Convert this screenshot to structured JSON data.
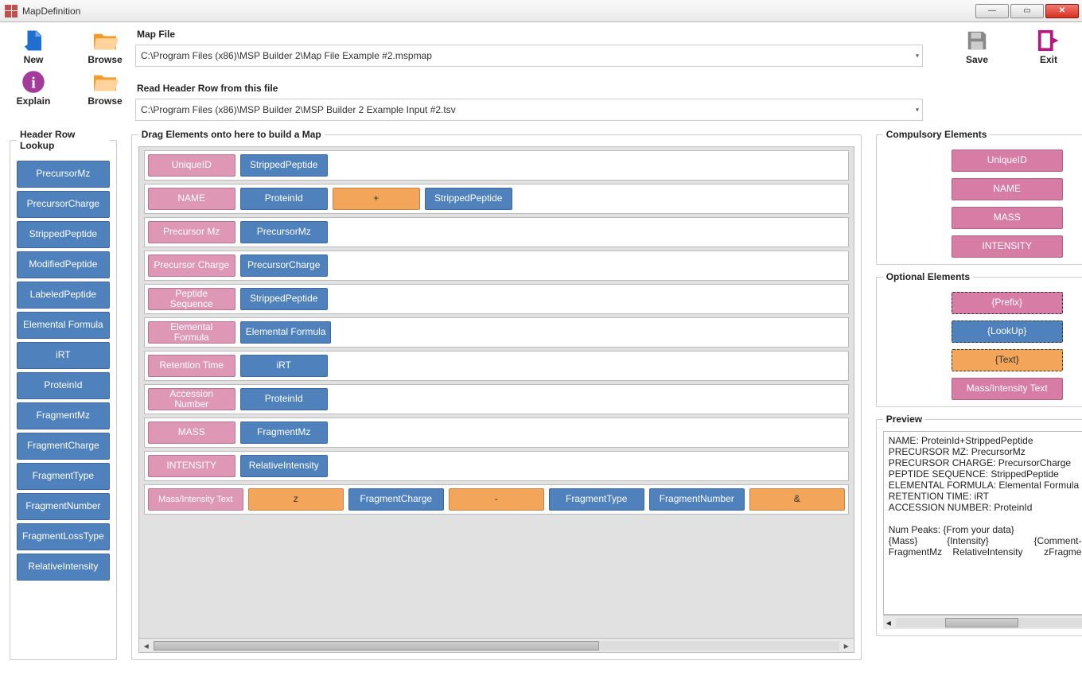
{
  "window": {
    "title": "MapDefinition"
  },
  "toolbar": {
    "new": "New",
    "browse1": "Browse",
    "explain": "Explain",
    "browse2": "Browse",
    "save": "Save",
    "exit": "Exit"
  },
  "files": {
    "map_label": "Map File",
    "map_value": "C:\\Program Files (x86)\\MSP Builder 2\\Map File Example #2.mspmap",
    "header_label": "Read Header Row from this file",
    "header_value": "C:\\Program Files (x86)\\MSP Builder 2\\MSP Builder 2 Example Input #2.tsv"
  },
  "lookup": {
    "title": "Header Row Lookup",
    "items": [
      "PrecursorMz",
      "PrecursorCharge",
      "StrippedPeptide",
      "ModifiedPeptide",
      "LabeledPeptide",
      "Elemental Formula",
      "iRT",
      "ProteinId",
      "FragmentMz",
      "FragmentCharge",
      "FragmentType",
      "FragmentNumber",
      "FragmentLossType",
      "RelativeIntensity"
    ]
  },
  "map": {
    "title": "Drag Elements onto here to build a Map",
    "rows": [
      {
        "label": "UniqueID",
        "items": [
          {
            "t": "StrippedPeptide",
            "c": "blue"
          }
        ]
      },
      {
        "label": "NAME",
        "items": [
          {
            "t": "ProteinId",
            "c": "blue"
          },
          {
            "t": "+",
            "c": "orange"
          },
          {
            "t": "StrippedPeptide",
            "c": "blue"
          }
        ]
      },
      {
        "label": "Precursor Mz",
        "items": [
          {
            "t": "PrecursorMz",
            "c": "blue"
          }
        ]
      },
      {
        "label": "Precursor Charge",
        "items": [
          {
            "t": "PrecursorCharge",
            "c": "blue"
          }
        ]
      },
      {
        "label": "Peptide Sequence",
        "items": [
          {
            "t": "StrippedPeptide",
            "c": "blue"
          }
        ]
      },
      {
        "label": "Elemental Formula",
        "items": [
          {
            "t": "Elemental Formula",
            "c": "blue"
          }
        ]
      },
      {
        "label": "Retention Time",
        "items": [
          {
            "t": "iRT",
            "c": "blue"
          }
        ]
      },
      {
        "label": "Accession Number",
        "items": [
          {
            "t": "ProteinId",
            "c": "blue"
          }
        ]
      },
      {
        "label": "MASS",
        "items": [
          {
            "t": "FragmentMz",
            "c": "blue"
          }
        ]
      },
      {
        "label": "INTENSITY",
        "items": [
          {
            "t": "RelativeIntensity",
            "c": "blue"
          }
        ]
      }
    ],
    "lastrow": {
      "label": "Mass/Intensity Text",
      "items": [
        {
          "t": "z",
          "c": "orange"
        },
        {
          "t": "FragmentCharge",
          "c": "blue"
        },
        {
          "t": "-",
          "c": "orange"
        },
        {
          "t": "FragmentType",
          "c": "blue"
        },
        {
          "t": "FragmentNumber",
          "c": "blue"
        },
        {
          "t": "&",
          "c": "orange"
        }
      ]
    }
  },
  "compulsory": {
    "title": "Compulsory Elements",
    "items": [
      "UniqueID",
      "NAME",
      "MASS",
      "INTENSITY"
    ]
  },
  "optional": {
    "title": "Optional Elements",
    "items": [
      {
        "t": "{Prefix}",
        "c": "pink",
        "d": true
      },
      {
        "t": "{LookUp}",
        "c": "blue",
        "d": true
      },
      {
        "t": "{Text}",
        "c": "orange",
        "d": true
      },
      {
        "t": "Mass/Intensity Text",
        "c": "pink",
        "d": false
      }
    ]
  },
  "preview": {
    "title": "Preview",
    "text": "NAME: ProteinId+StrippedPeptide\nPRECURSOR MZ: PrecursorMz\nPRECURSOR CHARGE: PrecursorCharge\nPEPTIDE SEQUENCE: StrippedPeptide\nELEMENTAL FORMULA: Elemental Formula\nRETENTION TIME: iRT\nACCESSION NUMBER: ProteinId\n\nNum Peaks: {From your data}\n{Mass}           {Intensity}                 {Comment-Optional}\nFragmentMz    RelativeIntensity        zFragmentCharge - Frag"
  }
}
